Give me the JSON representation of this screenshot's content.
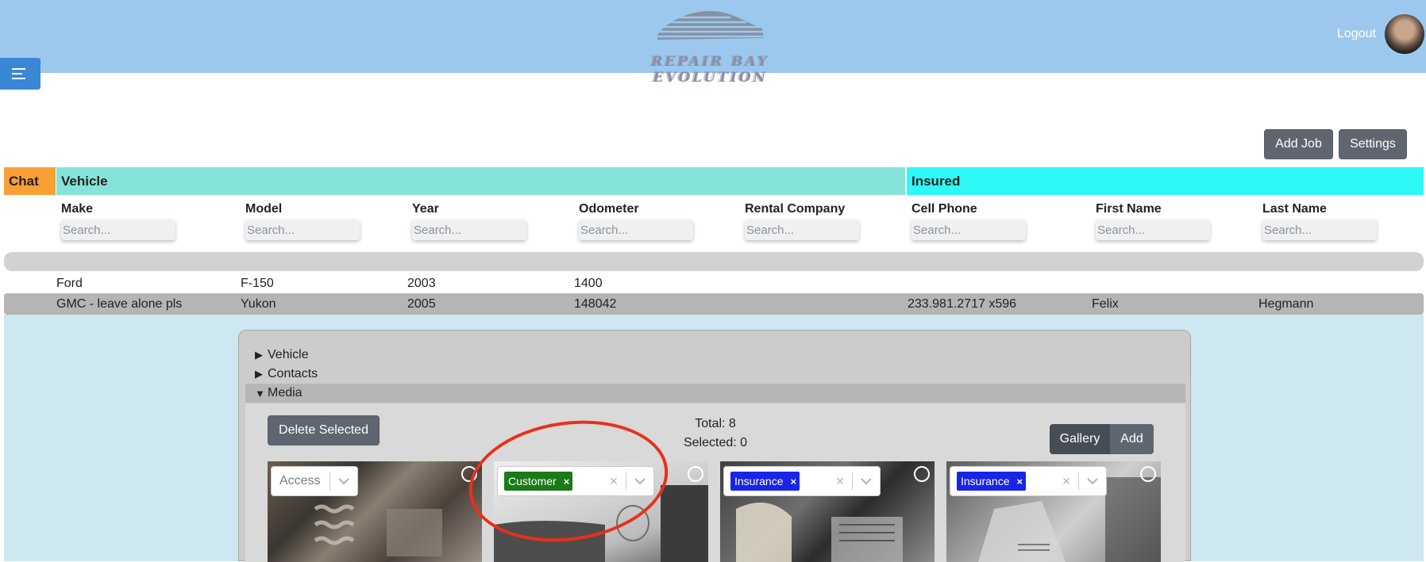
{
  "header": {
    "logo_text": "REPAIR BAY EVOLUTION",
    "logout_label": "Logout",
    "background": "#9cc8ed"
  },
  "actions": {
    "add_job": "Add Job",
    "settings": "Settings"
  },
  "groups": {
    "chat": {
      "label": "Chat",
      "color": "#f8a035"
    },
    "vehicle": {
      "label": "Vehicle",
      "color": "#86e3d9"
    },
    "insured": {
      "label": "Insured",
      "color": "#2ff9f6"
    }
  },
  "columns": [
    {
      "label": "Make",
      "placeholder": "Search..."
    },
    {
      "label": "Model",
      "placeholder": "Search..."
    },
    {
      "label": "Year",
      "placeholder": "Search..."
    },
    {
      "label": "Odometer",
      "placeholder": "Search..."
    },
    {
      "label": "Rental Company",
      "placeholder": "Search..."
    },
    {
      "label": "Cell Phone",
      "placeholder": "Search..."
    },
    {
      "label": "First Name",
      "placeholder": "Search..."
    },
    {
      "label": "Last Name",
      "placeholder": "Search..."
    }
  ],
  "rows": [
    {
      "make": "Ford",
      "model": "F-150",
      "year": "2003",
      "odometer": "1400",
      "rental": "",
      "phone": "",
      "first": "",
      "last": ""
    },
    {
      "make": "GMC - leave alone pls",
      "model": "Yukon",
      "year": "2005",
      "odometer": "148042",
      "rental": "",
      "phone": "233.981.2717 x596",
      "first": "Felix",
      "last": "Hegmann"
    }
  ],
  "detail": {
    "sections": [
      "Vehicle",
      "Contacts",
      "Media"
    ],
    "media": {
      "delete_selected": "Delete Selected",
      "total": "Total: 8",
      "selected": "Selected: 0",
      "view_gallery": "Gallery",
      "view_add": "Add",
      "items": [
        {
          "tag": "",
          "placeholder": "Access",
          "icons": [
            "chevron-down-icon"
          ]
        },
        {
          "tag": "Customer",
          "tag_color": "#1a7a1a"
        },
        {
          "tag": "Insurance",
          "tag_color": "#1a24e6"
        },
        {
          "tag": "Insurance",
          "tag_color": "#1a24e6"
        }
      ],
      "remove_symbol": "×",
      "clear_symbol": "×"
    }
  },
  "annotation_color": "#e8301c"
}
